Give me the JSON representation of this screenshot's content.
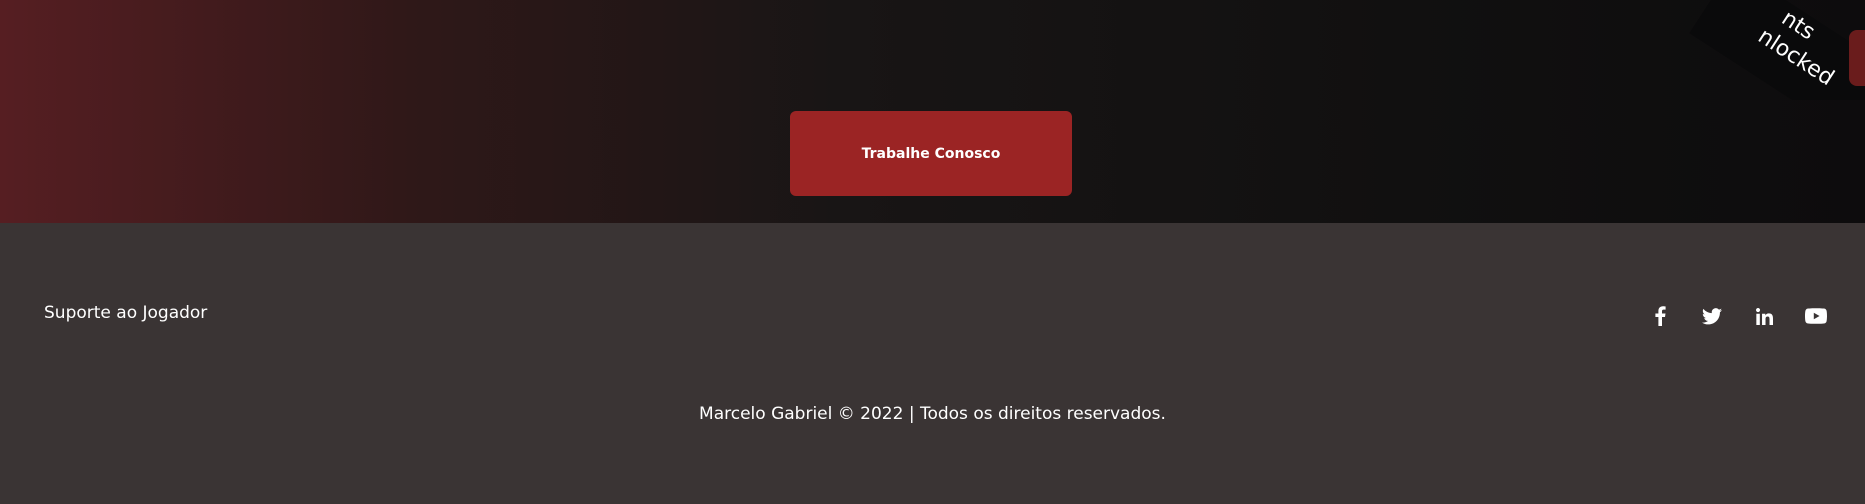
{
  "hero": {
    "cta_label": "Trabalhe Conosco",
    "ribbon_line1": "nts",
    "ribbon_line2": "nlocked"
  },
  "footer": {
    "support_label": "Suporte ao Jogador",
    "social_icons": [
      "facebook-icon",
      "twitter-icon",
      "linkedin-icon",
      "youtube-icon"
    ],
    "copyright": "Marcelo Gabriel © 2022 | Todos os direitos reservados."
  },
  "colors": {
    "cta": "#9b2424",
    "footer_bg": "#3a3434",
    "hero_gradient_start": "#561e22",
    "hero_gradient_end": "#0d0c0d"
  }
}
